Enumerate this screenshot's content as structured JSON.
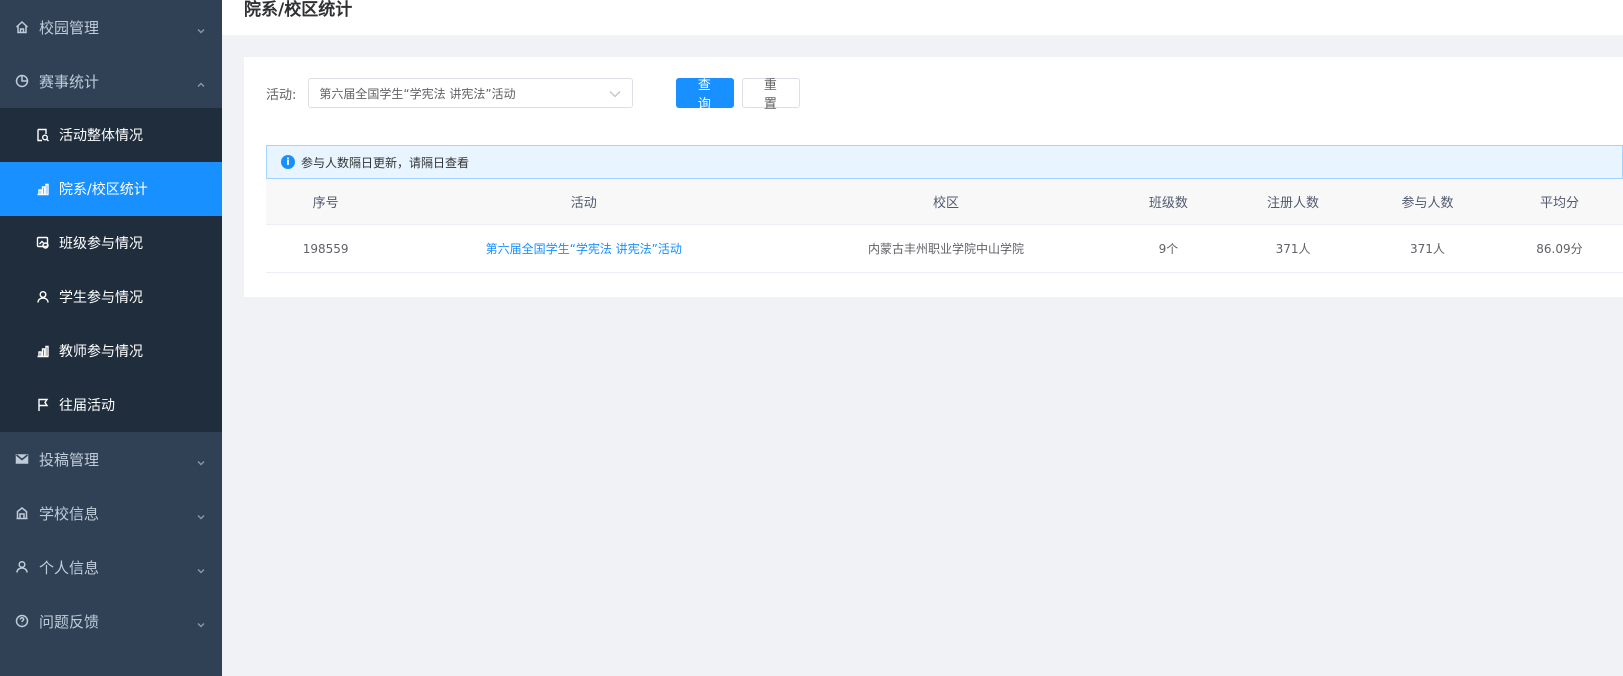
{
  "sidebar": {
    "menus": [
      {
        "label": "校园管理",
        "icon": "home-icon",
        "expanded": false
      },
      {
        "label": "赛事统计",
        "icon": "pie-chart-icon",
        "expanded": true
      },
      {
        "label": "投稿管理",
        "icon": "mail-icon",
        "expanded": false
      },
      {
        "label": "学校信息",
        "icon": "building-icon",
        "expanded": false
      },
      {
        "label": "个人信息",
        "icon": "user-icon",
        "expanded": false
      },
      {
        "label": "问题反馈",
        "icon": "question-icon",
        "expanded": false
      }
    ],
    "submenu": [
      {
        "label": "活动整体情况",
        "icon": "report-search-icon"
      },
      {
        "label": "院系/校区统计",
        "icon": "bar-chart-icon",
        "active": true
      },
      {
        "label": "班级参与情况",
        "icon": "image-gear-icon"
      },
      {
        "label": "学生参与情况",
        "icon": "user-icon"
      },
      {
        "label": "教师参与情况",
        "icon": "bar-chart-icon"
      },
      {
        "label": "往届活动",
        "icon": "flag-icon"
      }
    ]
  },
  "page": {
    "title": "院系/校区统计"
  },
  "filter": {
    "label": "活动:",
    "selected": "第六届全国学生“学宪法 讲宪法”活动",
    "query_label": "查询",
    "reset_label": "重置"
  },
  "alert": {
    "text": "参与人数隔日更新，请隔日查看"
  },
  "table": {
    "headers": [
      "序号",
      "活动",
      "校区",
      "班级数",
      "注册人数",
      "参与人数",
      "平均分"
    ],
    "rows": [
      [
        "198559",
        "第六届全国学生“学宪法 讲宪法”活动",
        "内蒙古丰州职业学院中山学院",
        "9个",
        "371人",
        "371人",
        "86.09分"
      ]
    ]
  },
  "colors": {
    "sidebar_bg": "#304156",
    "submenu_bg": "#1f2d3d",
    "accent": "#1890ff"
  }
}
